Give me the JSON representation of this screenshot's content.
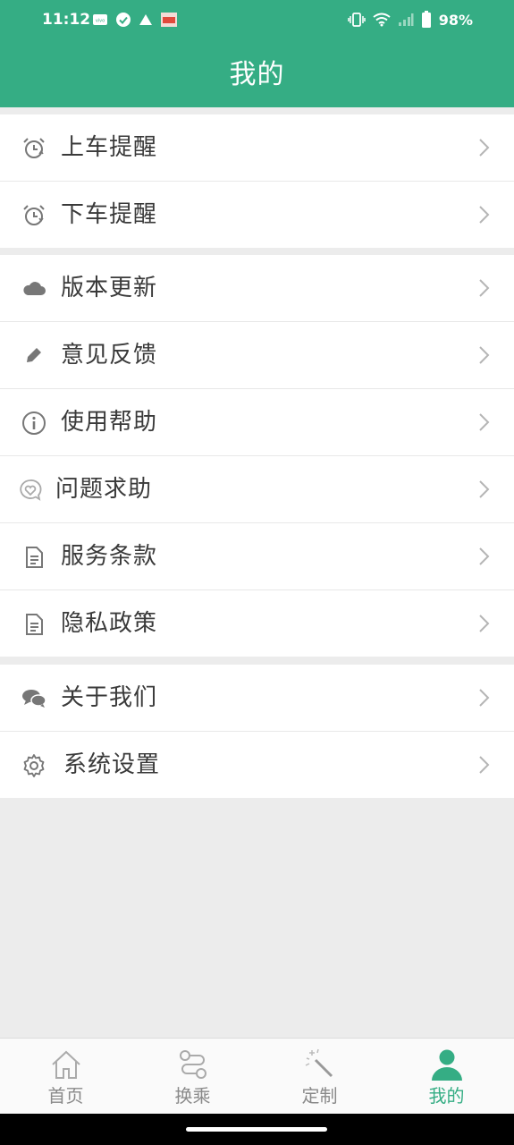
{
  "status_bar": {
    "time": "11:12",
    "battery": "98%",
    "left_icons": [
      "vivo-icon",
      "check-circle-icon",
      "warning-icon",
      "app-notification-icon"
    ],
    "right_icons": [
      "vibrate-icon",
      "wifi-icon",
      "signal-icon",
      "battery-icon"
    ]
  },
  "header": {
    "title": "我的"
  },
  "groups": [
    {
      "items": [
        {
          "icon": "alarm-clock-up-icon",
          "label": "上车提醒"
        },
        {
          "icon": "alarm-clock-down-icon",
          "label": "下车提醒"
        }
      ]
    },
    {
      "items": [
        {
          "icon": "cloud-icon",
          "label": "版本更新"
        },
        {
          "icon": "pencil-icon",
          "label": "意见反馈"
        },
        {
          "icon": "info-icon",
          "label": "使用帮助"
        },
        {
          "icon": "heart-chat-icon",
          "label": "问题求助"
        },
        {
          "icon": "document-icon",
          "label": "服务条款"
        },
        {
          "icon": "document-icon",
          "label": "隐私政策"
        }
      ]
    },
    {
      "items": [
        {
          "icon": "chat-bubbles-icon",
          "label": "关于我们"
        },
        {
          "icon": "gear-icon",
          "label": "系统设置"
        }
      ]
    }
  ],
  "tabs": [
    {
      "icon": "home-icon",
      "label": "首页",
      "active": false
    },
    {
      "icon": "route-icon",
      "label": "换乘",
      "active": false
    },
    {
      "icon": "magic-wand-icon",
      "label": "定制",
      "active": false
    },
    {
      "icon": "person-icon",
      "label": "我的",
      "active": true
    }
  ],
  "colors": {
    "accent": "#35ad84",
    "background": "#ececec",
    "text": "#3a3a3a",
    "icon": "#777777"
  }
}
